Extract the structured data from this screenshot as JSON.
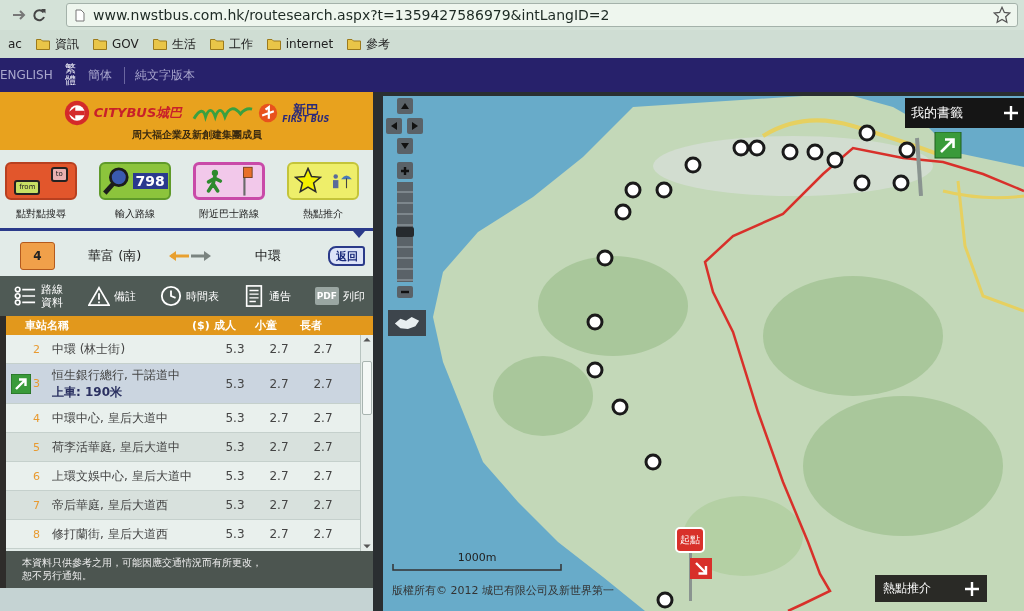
{
  "browser": {
    "url": "www.nwstbus.com.hk/routesearch.aspx?t=1359427586979&intLangID=2",
    "bookmarks": [
      {
        "label": "ac",
        "kind": "page"
      },
      {
        "label": "資訊",
        "kind": "folder"
      },
      {
        "label": "GOV",
        "kind": "folder"
      },
      {
        "label": "生活",
        "kind": "folder"
      },
      {
        "label": "工作",
        "kind": "folder"
      },
      {
        "label": "internet",
        "kind": "folder"
      },
      {
        "label": "參考",
        "kind": "folder"
      }
    ]
  },
  "language_bar": {
    "languages": [
      {
        "label": "ENGLISH",
        "selected": false
      },
      {
        "label": "繁體",
        "selected": true
      },
      {
        "label": "簡体",
        "selected": false
      }
    ],
    "text_version": "純文字版本"
  },
  "header": {
    "citybus_logo": "CITYBUS城巴",
    "firstbus_logo": "新巴",
    "firstbus_subtitle": "FIRST BUS",
    "tagline": "周大福企業及新創建集團成員"
  },
  "quick_links": [
    {
      "label": "點對點搜尋",
      "kind": "point",
      "from_text": "from",
      "to_text": "to"
    },
    {
      "label": "輸入路線",
      "kind": "route",
      "badge": "798"
    },
    {
      "label": "附近巴士路線",
      "kind": "nearby"
    },
    {
      "label": "熱點推介",
      "kind": "hotspot"
    }
  ],
  "route": {
    "number": "4",
    "origin": "華富 (南)",
    "destination": "中環",
    "back_button": "返回"
  },
  "toolbar": [
    {
      "label": "路線資料",
      "kind": "info"
    },
    {
      "label": "備註",
      "kind": "remarks"
    },
    {
      "label": "時間表",
      "kind": "timetable"
    },
    {
      "label": "通告",
      "kind": "notice"
    },
    {
      "label": "列印",
      "kind": "print",
      "badge": "PDF"
    }
  ],
  "fare_table": {
    "columns": [
      "車站名稱",
      "($) 成人",
      "小童",
      "長者"
    ],
    "rows": [
      {
        "number": "2",
        "stop": "中環 (林士街)",
        "adult": "5.3",
        "child": "2.7",
        "senior": "2.7",
        "selected": false
      },
      {
        "number": "3",
        "stop": "恒生銀行總行, 干諾道中",
        "boarding": "上車: 190米",
        "adult": "5.3",
        "child": "2.7",
        "senior": "2.7",
        "selected": true
      },
      {
        "number": "4",
        "stop": "中環中心, 皇后大道中",
        "adult": "5.3",
        "child": "2.7",
        "senior": "2.7",
        "selected": false
      },
      {
        "number": "5",
        "stop": "荷李活華庭, 皇后大道中",
        "adult": "5.3",
        "child": "2.7",
        "senior": "2.7",
        "selected": false
      },
      {
        "number": "6",
        "stop": "上環文娛中心, 皇后大道中",
        "adult": "5.3",
        "child": "2.7",
        "senior": "2.7",
        "selected": false
      },
      {
        "number": "7",
        "stop": "帝后華庭, 皇后大道西",
        "adult": "5.3",
        "child": "2.7",
        "senior": "2.7",
        "selected": false
      },
      {
        "number": "8",
        "stop": "修打蘭街, 皇后大道西",
        "adult": "5.3",
        "child": "2.7",
        "senior": "2.7",
        "selected": false
      }
    ]
  },
  "notice": "本資料只供參考之用，可能因應交通情況而有所更改，恕不另行通知。",
  "map": {
    "zoom_slider": {
      "level": 0.5
    },
    "bookmarks_panel": "我的書籤",
    "start_marker": "起點",
    "scale": "1000m",
    "copyright": "版權所有© 2012 城巴有限公司及新世界第一",
    "hotspot_panel": "熱點推介"
  }
}
